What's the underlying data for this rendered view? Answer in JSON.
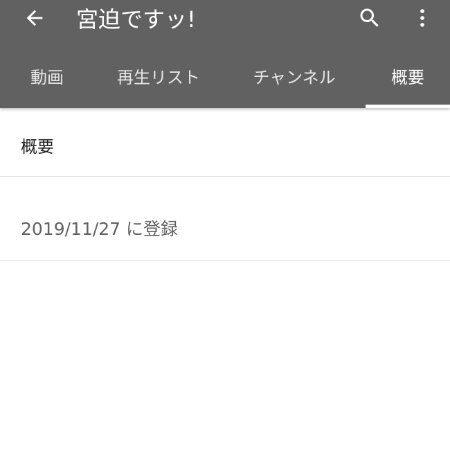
{
  "header": {
    "title": "宮迫ですッ!",
    "back_icon": "arrow-left-icon",
    "search_icon": "search-icon",
    "more_icon": "more-vertical-icon",
    "background_color": "#616161"
  },
  "tabs": [
    {
      "label": "動画",
      "active": false
    },
    {
      "label": "再生リスト",
      "active": false
    },
    {
      "label": "チャンネル",
      "active": false
    },
    {
      "label": "概要",
      "active": true
    }
  ],
  "about": {
    "heading": "概要",
    "joined": "2019/11/27 に登録"
  }
}
